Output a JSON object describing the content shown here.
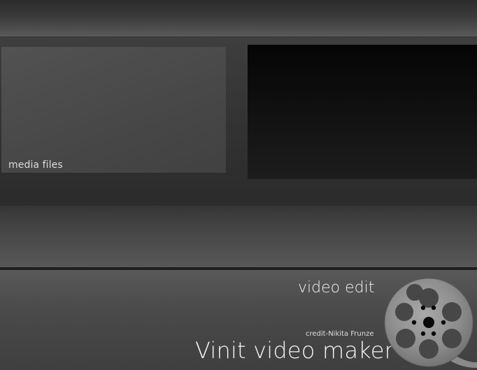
{
  "media_panel": {
    "label": "media files"
  },
  "preview_panel": {},
  "bottom_panel": {
    "video_edit_label": "video edit",
    "credit": "credit-Nikita Frunze",
    "app_title": "Vinit video maker"
  },
  "logo": {
    "icon": "film-reel-icon"
  },
  "colors": {
    "background": "#2a2a2a",
    "media_tile": "#4c4c4c",
    "preview": "#0a0a0a",
    "bottom_panel": "#4e4e4e",
    "text": "#f0f0f0"
  }
}
